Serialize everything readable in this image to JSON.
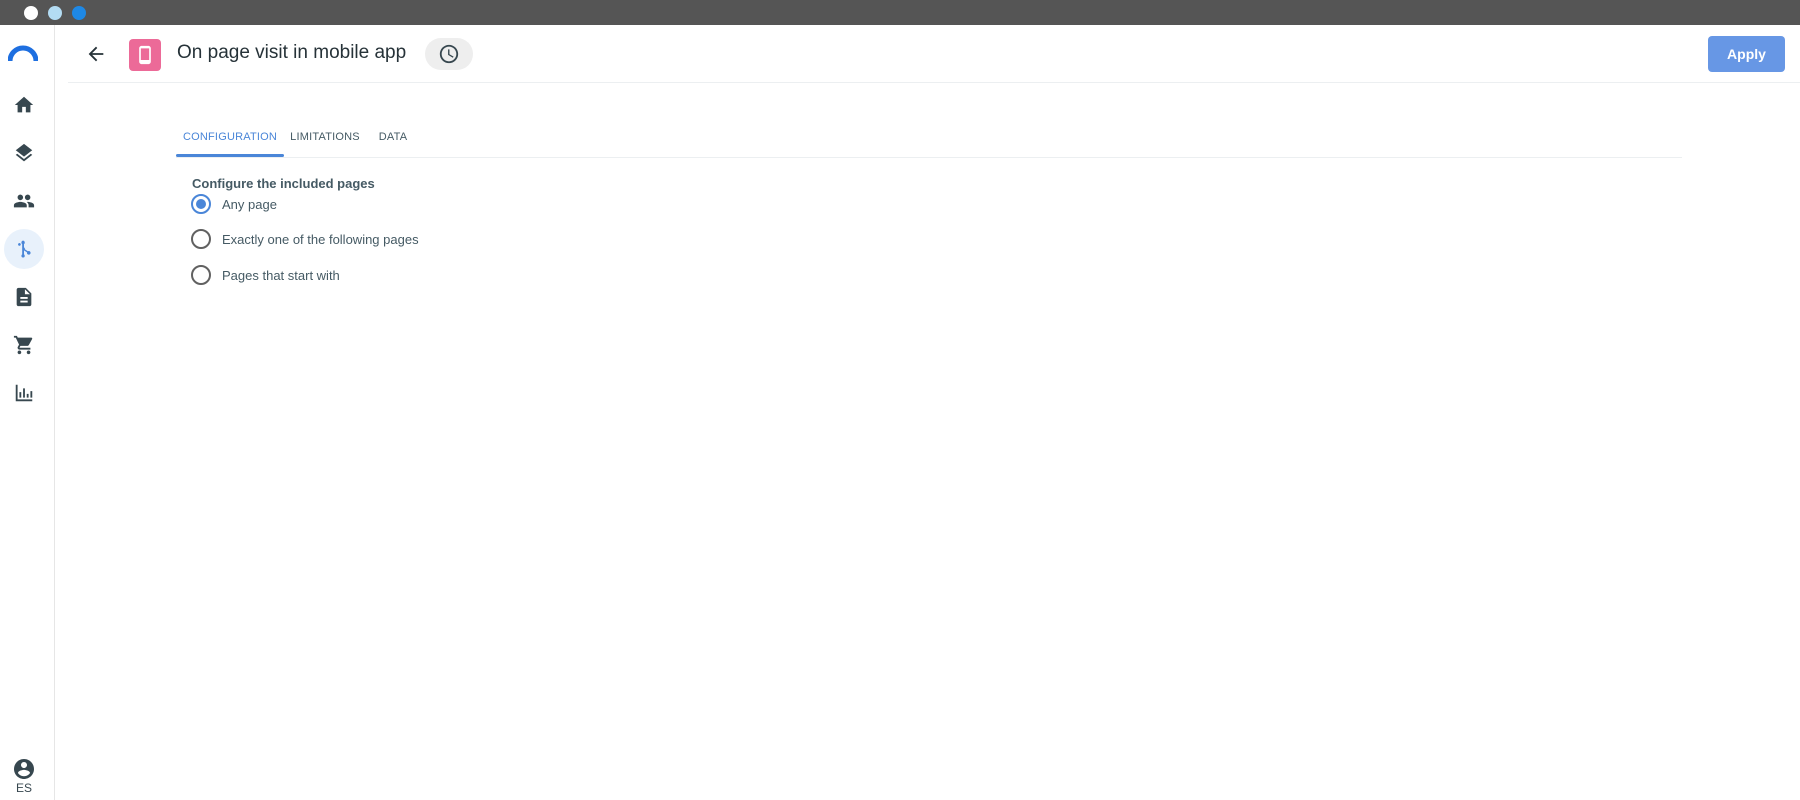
{
  "header": {
    "title": "On page visit in mobile app",
    "apply_label": "Apply"
  },
  "sidebar": {
    "items": [
      {
        "icon": "home-icon"
      },
      {
        "icon": "layers-icon"
      },
      {
        "icon": "people-icon"
      },
      {
        "icon": "flow-icon",
        "active": true
      },
      {
        "icon": "document-icon"
      },
      {
        "icon": "cart-icon"
      },
      {
        "icon": "bar-chart-icon"
      }
    ],
    "user_initials": "ES"
  },
  "tabs": [
    {
      "label": "CONFIGURATION",
      "active": true
    },
    {
      "label": "LIMITATIONS"
    },
    {
      "label": "DATA"
    }
  ],
  "configuration": {
    "section_label": "Configure the included pages",
    "options": [
      {
        "label": "Any page",
        "checked": true
      },
      {
        "label": "Exactly one of the following pages",
        "checked": false
      },
      {
        "label": "Pages that start with",
        "checked": false
      }
    ]
  },
  "colors": {
    "accent": "#4a86d8",
    "apply_button": "#6797e5",
    "badge": "#ec6a98"
  }
}
